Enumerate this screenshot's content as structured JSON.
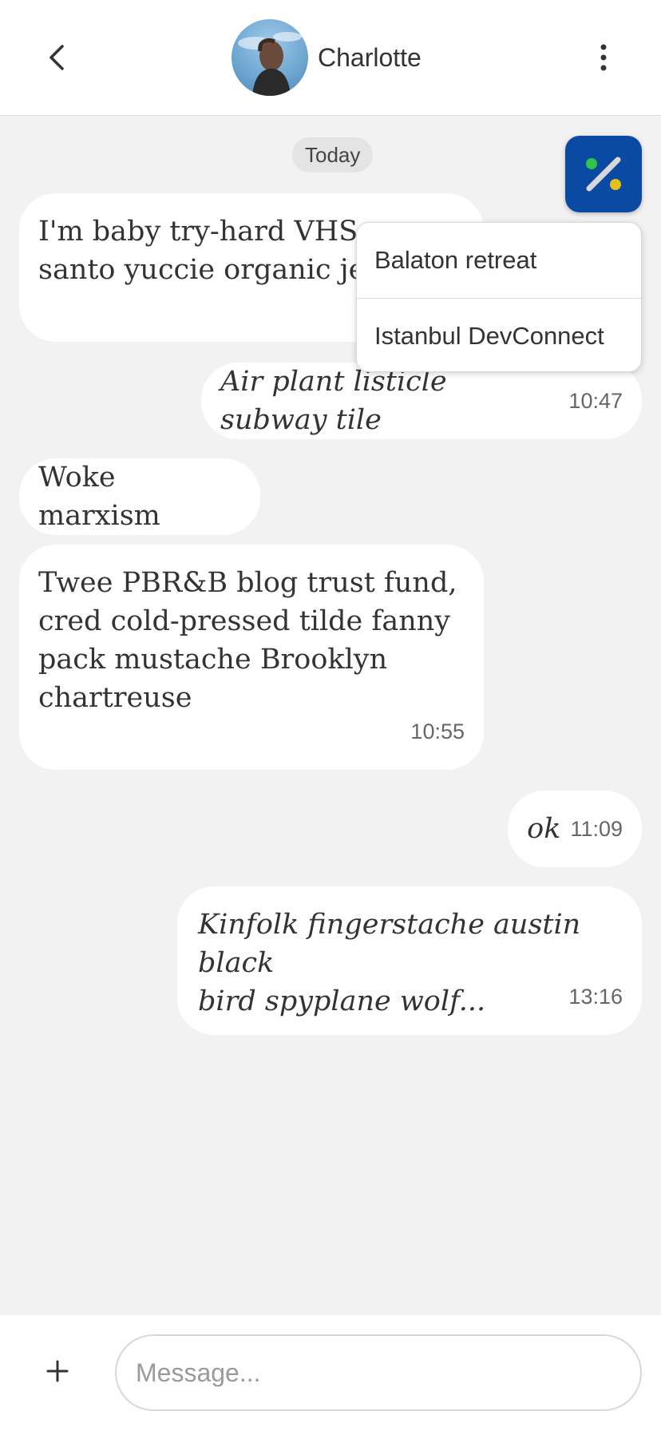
{
  "header": {
    "back_icon": "chevron-left-icon",
    "contact_name": "Charlotte",
    "more_icon": "vertical-dots-icon"
  },
  "date_label": "Today",
  "fab": {
    "icon": "percent-icon",
    "color": "#0b4aa2"
  },
  "dropdown": {
    "items": [
      {
        "label": "Balaton retreat"
      },
      {
        "label": "Istanbul DevConnect"
      }
    ]
  },
  "messages": [
    {
      "direction": "incoming",
      "text_lines": [
        "I'm baby try-hard VHS p",
        "santo yuccie organic jea"
      ],
      "style": "normal"
    },
    {
      "direction": "outgoing",
      "text": "Air plant listicle subway tile",
      "time": "10:47",
      "style": "italic"
    },
    {
      "direction": "incoming",
      "text": "Woke marxism",
      "style": "normal"
    },
    {
      "direction": "incoming",
      "text_lines": [
        "Twee PBR&B blog trust fund,",
        "cred cold-pressed tilde fanny",
        "pack mustache Brooklyn",
        "chartreuse"
      ],
      "time": "10:55",
      "style": "normal"
    },
    {
      "direction": "outgoing",
      "text": "ok",
      "time": "11:09",
      "style": "italic"
    },
    {
      "direction": "outgoing",
      "text_lines": [
        "Kinfolk fingerstache austin black",
        "bird spyplane wolf..."
      ],
      "time": "13:16",
      "style": "italic"
    }
  ],
  "composer": {
    "add_icon": "plus-icon",
    "placeholder": "Message..."
  },
  "colors": {
    "background": "#f2f2f2",
    "bubble": "#ffffff",
    "accent": "#0b4aa2"
  }
}
